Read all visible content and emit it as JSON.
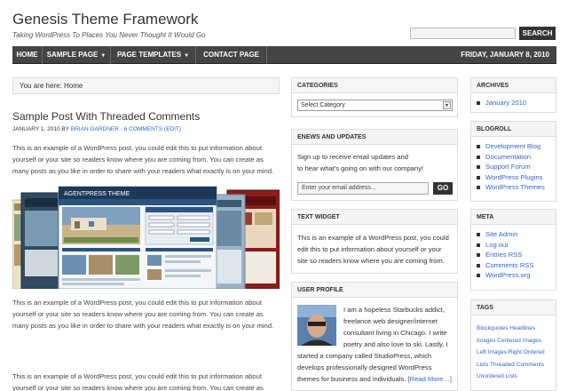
{
  "header": {
    "title": "Genesis Theme Framework",
    "tagline": "Taking WordPress To Places You Never Thought It Would Go",
    "search_button": "SEARCH"
  },
  "nav": {
    "items": [
      {
        "label": "HOME",
        "dropdown": false
      },
      {
        "label": "SAMPLE PAGE",
        "dropdown": true
      },
      {
        "label": "PAGE TEMPLATES",
        "dropdown": true
      },
      {
        "label": "CONTACT PAGE",
        "dropdown": false
      }
    ],
    "date": "FRIDAY, JANUARY 8, 2010"
  },
  "breadcrumb": "You are here: Home",
  "post": {
    "title": "Sample Post With Threaded Comments",
    "date": "JANUARY 1, 2010 BY",
    "author": "BRIAN GARDNER",
    "separator": "·",
    "comments": "6 COMMENTS",
    "edit": "(EDIT)",
    "paragraph": "This is an example of a WordPress post, you could edit this to put information about yourself or your site so readers know where you are coming from. You can create as many posts as you like in order to share with your readers what exactly is on your mind."
  },
  "screenshot_labels": {
    "theme_name": "AGENTPRESS THEME",
    "back_theme": "AGENTPRESS THEME"
  },
  "middle_sidebar": {
    "categories": {
      "title": "CATEGORIES",
      "select": "Select Category"
    },
    "enews": {
      "title": "ENEWS AND UPDATES",
      "text1": "Sign up to receive email updates and",
      "text2": "to hear what's going on with our company!",
      "email_placeholder": "Enter your email address...",
      "go": "GO"
    },
    "text_widget": {
      "title": "TEXT WIDGET",
      "lines": [
        "This is an example of a WordPress post, you could",
        "edit this to put information about yourself or your",
        "site so readers know where you are coming from."
      ]
    },
    "profile": {
      "title": "USER PROFILE",
      "lines": [
        "I am a hopeless Starbucks addict,",
        "freelance web designer/internet",
        "consultant living in Chicago. I write",
        "poetry and also love to ski. Lastly, I"
      ],
      "wide_lines": [
        "started a company called StudioPress, which",
        "develops professionally designed WordPress"
      ],
      "last_line": "themes for business and individuals.",
      "read_more": "[Read More…]"
    }
  },
  "right_sidebar": {
    "archives": {
      "title": "ARCHIVES",
      "items": [
        "January 2010"
      ]
    },
    "blogroll": {
      "title": "BLOGROLL",
      "items": [
        "Development Blog",
        "Documentation",
        "Support Forum",
        "WordPress Plugins",
        "WordPress Themes"
      ]
    },
    "meta": {
      "title": "META",
      "items": [
        "Site Admin",
        "Log out",
        "Entries RSS",
        "Comments RSS",
        "WordPress.org"
      ]
    },
    "tags": {
      "title": "TAGS",
      "items": [
        "Blockquotes Headlines",
        "Images Centered Images",
        "Left Images Right Ordered",
        "Lists Threaded Comments",
        "Unordered Lists"
      ]
    }
  }
}
